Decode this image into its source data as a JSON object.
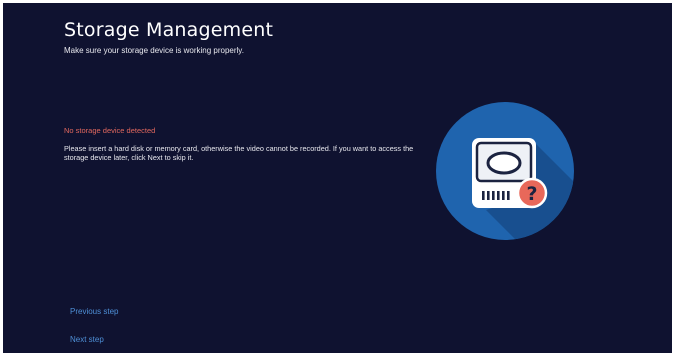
{
  "header": {
    "title": "Storage Management",
    "subtitle": "Make sure your storage device is working properly."
  },
  "status": {
    "error_text": "No storage device detected",
    "message": "Please insert a hard disk or memory card, otherwise the video cannot be recorded. If you want to access the storage device later, click Next to skip it."
  },
  "navigation": {
    "previous_label": "Previous step",
    "next_label": "Next step"
  },
  "illustration": {
    "icon": "hard-disk-question-icon",
    "question_glyph": "?"
  },
  "colors": {
    "background": "#0f1230",
    "error": "#e2685e",
    "link": "#4e8fd6",
    "circle": "#1f64ae",
    "badge": "#e8685a"
  }
}
